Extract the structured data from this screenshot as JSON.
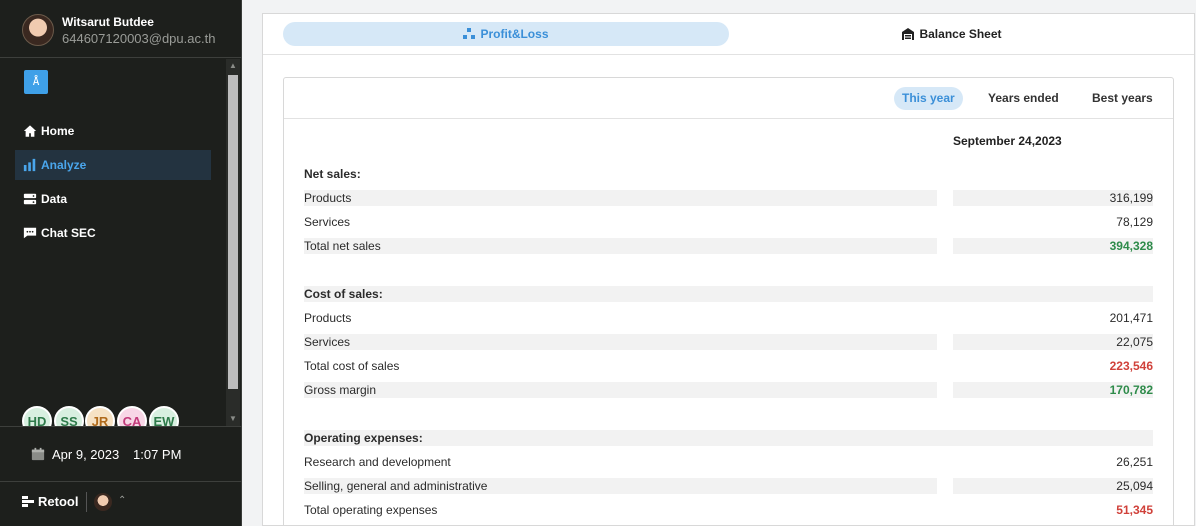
{
  "user": {
    "name": "Witsarut Butdee",
    "email": "644607120003@dpu.ac.th"
  },
  "nav": [
    {
      "label": "Home",
      "icon": "home-icon",
      "active": false
    },
    {
      "label": "Analyze",
      "icon": "bar-chart-icon",
      "active": true
    },
    {
      "label": "Data",
      "icon": "server-icon",
      "active": false
    },
    {
      "label": "Chat SEC",
      "icon": "chat-icon",
      "active": false
    }
  ],
  "collaborators": [
    {
      "initials": "HD",
      "bg": "#d8efe0",
      "fg": "#2e7a4a"
    },
    {
      "initials": "SS",
      "bg": "#d8efe0",
      "fg": "#2e7a4a"
    },
    {
      "initials": "JR",
      "bg": "#f6e2c4",
      "fg": "#b06a1a"
    },
    {
      "initials": "CA",
      "bg": "#f8d6e6",
      "fg": "#c23a7a"
    },
    {
      "initials": "EW",
      "bg": "#d8efe0",
      "fg": "#2e7a4a"
    }
  ],
  "footer": {
    "date": "Apr 9, 2023",
    "time": "1:07 PM",
    "brand": "Retool"
  },
  "tabs": {
    "profit_loss": "Profit&Loss",
    "balance_sheet": "Balance Sheet"
  },
  "periods": {
    "this_year": "This year",
    "years_ended": "Years ended",
    "best_years": "Best years"
  },
  "column_header": "September 24,2023",
  "rows": [
    {
      "label": "Net sales:",
      "value": "",
      "type": "header",
      "shaded": false
    },
    {
      "label": "Products",
      "value": "316,199",
      "type": "item",
      "shaded": true
    },
    {
      "label": "Services",
      "value": "78,129",
      "type": "item",
      "shaded": false
    },
    {
      "label": "Total net sales",
      "value": "394,328",
      "type": "total",
      "color": "green",
      "shaded": true
    },
    {
      "label": "Cost of sales:",
      "value": "",
      "type": "header",
      "shaded": true
    },
    {
      "label": "Products",
      "value": "201,471",
      "type": "item",
      "shaded": false
    },
    {
      "label": "Services",
      "value": "22,075",
      "type": "item",
      "shaded": true
    },
    {
      "label": "Total cost of sales",
      "value": "223,546",
      "type": "total",
      "color": "red",
      "shaded": false
    },
    {
      "label": "Gross margin",
      "value": "170,782",
      "type": "total",
      "color": "green",
      "shaded": true
    },
    {
      "label": "Operating expenses:",
      "value": "",
      "type": "header",
      "shaded": true
    },
    {
      "label": "Research and development",
      "value": "26,251",
      "type": "item",
      "shaded": false
    },
    {
      "label": "Selling, general and administrative",
      "value": "25,094",
      "type": "item",
      "shaded": true
    },
    {
      "label": "Total operating expenses",
      "value": "51,345",
      "type": "total",
      "color": "red",
      "shaded": false
    }
  ]
}
